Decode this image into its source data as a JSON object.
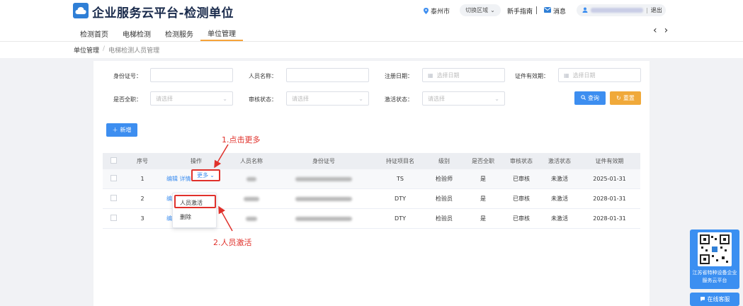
{
  "header": {
    "title": "企业服务云平台-检测单位",
    "city": "泰州市",
    "switch_region": "切换区域",
    "guide": "新手指南",
    "messages": "消息",
    "logout": "退出"
  },
  "nav": {
    "tabs": [
      {
        "label": "检测首页"
      },
      {
        "label": "电梯检测"
      },
      {
        "label": "检测服务"
      },
      {
        "label": "单位管理"
      }
    ],
    "active_tab": "单位管理"
  },
  "breadcrumb": {
    "root": "单位管理",
    "separator": "/",
    "current": "电梯检测人员管理"
  },
  "filters": {
    "id_label": "身份证号：",
    "name_label": "人员名称：",
    "reg_date_label": "注册日期：",
    "reg_date_placeholder": "选择日期",
    "cert_valid_label": "证件有效期：",
    "cert_valid_placeholder": "选择日期",
    "fulltime_label": "是否全职：",
    "fulltime_placeholder": "请选择",
    "audit_label": "审核状态：",
    "audit_placeholder": "请选择",
    "activate_label": "激活状态：",
    "activate_placeholder": "请选择"
  },
  "buttons": {
    "query": "查询",
    "reset": "重置",
    "add": "新增"
  },
  "table": {
    "headers": [
      "序号",
      "操作",
      "人员名称",
      "身份证号",
      "持证项目名",
      "级别",
      "是否全职",
      "审核状态",
      "激活状态",
      "证件有效期"
    ],
    "edit_label": "编辑",
    "detail_label": "详情",
    "more_label": "更多",
    "rows": [
      {
        "index": "1",
        "cert_item": "TS",
        "level": "检验师",
        "fulltime": "是",
        "audit": "已审核",
        "activate": "未激活",
        "valid_date": "2025-01-31"
      },
      {
        "index": "2",
        "cert_item": "DTY",
        "level": "检验员",
        "fulltime": "是",
        "audit": "已审核",
        "activate": "未激活",
        "valid_date": "2028-01-31"
      },
      {
        "index": "3",
        "cert_item": "DTY",
        "level": "检验员",
        "fulltime": "是",
        "audit": "已审核",
        "activate": "未激活",
        "valid_date": "2028-01-31"
      }
    ]
  },
  "dropdown": {
    "items": [
      {
        "label": "人员激活"
      },
      {
        "label": "删除"
      }
    ]
  },
  "annotations": {
    "step1": "1.点击更多",
    "step2": "2.人员激活"
  },
  "widgets": {
    "qr_caption": "江苏省特种设备企业服务云平台",
    "online_service": "在线客服"
  },
  "colors": {
    "accent_blue": "#3d8ef0",
    "reset_orange": "#f0a93a",
    "annotation_red": "#e0312b",
    "tab_underline": "#f6a339"
  },
  "icons": [
    "cloud-logo-icon",
    "location-pin-icon",
    "chevron-down-icon",
    "mail-icon",
    "user-icon",
    "calendar-icon",
    "search-icon",
    "refresh-icon",
    "plus-icon",
    "chat-icon",
    "qr-code-icon"
  ]
}
